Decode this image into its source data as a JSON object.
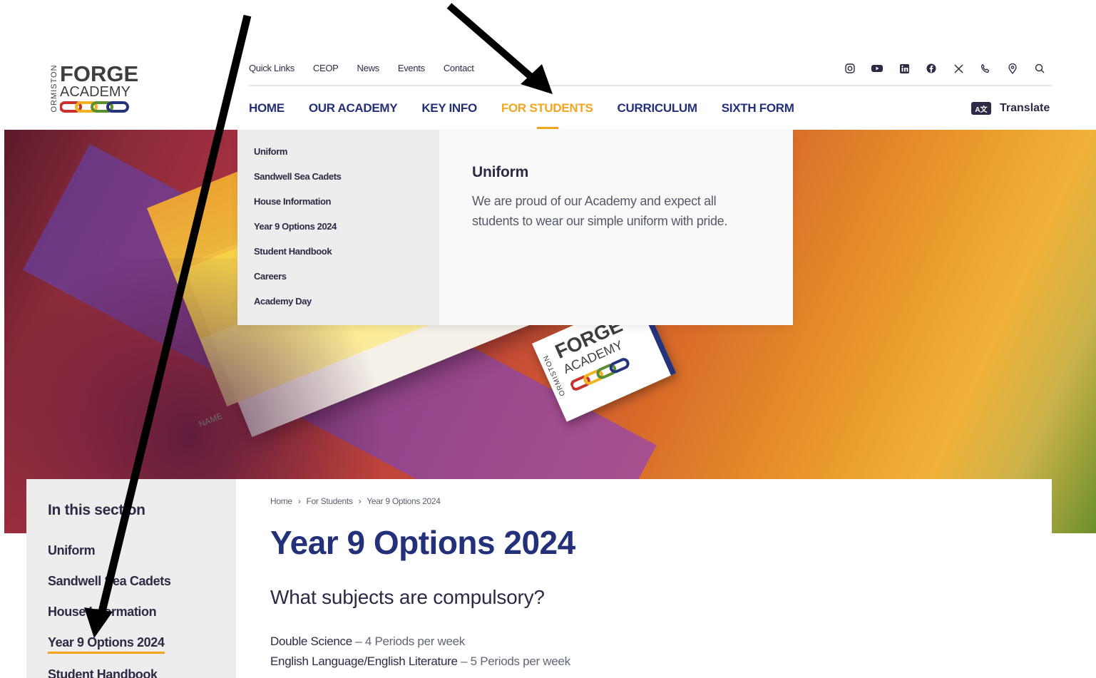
{
  "logo": {
    "vertical": "ORMISTON",
    "forge": "FORGE",
    "academy": "ACADEMY"
  },
  "top_links": [
    "Quick Links",
    "CEOP",
    "News",
    "Events",
    "Contact"
  ],
  "social_icons": [
    "instagram-icon",
    "youtube-icon",
    "linkedin-icon",
    "facebook-icon",
    "x-icon",
    "phone-icon",
    "location-icon",
    "search-icon"
  ],
  "main_nav": [
    "HOME",
    "OUR ACADEMY",
    "KEY INFO",
    "FOR STUDENTS",
    "CURRICULUM",
    "SIXTH FORM"
  ],
  "active_nav": "FOR STUDENTS",
  "translate": {
    "icon": "translate-icon",
    "label": "Translate"
  },
  "dropdown": {
    "items": [
      "Uniform",
      "Sandwell Sea Cadets",
      "House Information",
      "Year 9 Options 2024",
      "Student Handbook",
      "Careers",
      "Academy Day"
    ],
    "preview_title": "Uniform",
    "preview_text": "We are proud of our Academy and expect all students to wear our simple uniform with pride."
  },
  "hero": {
    "name_label": "NAME",
    "tag_forge": "FORGE",
    "tag_academy": "ACADEMY",
    "tag_ormiston": "ORMISTON"
  },
  "sidebar": {
    "heading": "In this section",
    "items": [
      "Uniform",
      "Sandwell Sea Cadets",
      "House Information",
      "Year 9 Options 2024",
      "Student Handbook"
    ],
    "active": "Year 9 Options 2024"
  },
  "breadcrumb": [
    "Home",
    "For Students",
    "Year 9 Options 2024"
  ],
  "page": {
    "title": "Year 9 Options 2024",
    "subheading": "What subjects are compulsory?",
    "subjects": [
      {
        "name": "Double Science",
        "detail": " – 4 Periods per week"
      },
      {
        "name": "English Language/English Literature",
        "detail": " – 5 Periods per week"
      }
    ]
  },
  "colors": {
    "navy": "#23307a",
    "accent": "#f3a51f",
    "text": "#2b2b45"
  }
}
